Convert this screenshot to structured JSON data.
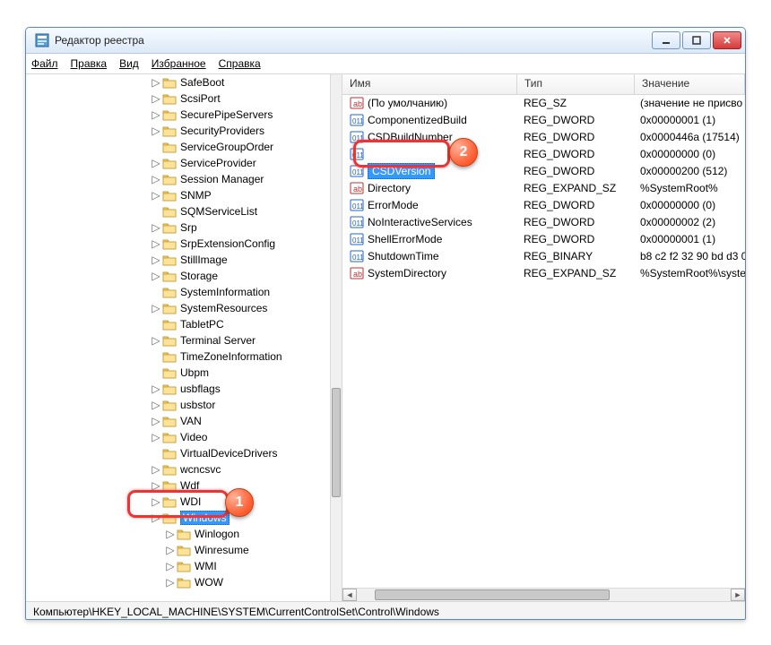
{
  "window": {
    "title": "Редактор реестра"
  },
  "menu": {
    "file": "Файл",
    "edit": "Правка",
    "view": "Вид",
    "favorites": "Избранное",
    "help": "Справка"
  },
  "tree": {
    "items": [
      {
        "label": "SafeBoot",
        "expandable": true,
        "indent": 0
      },
      {
        "label": "ScsiPort",
        "expandable": true,
        "indent": 0
      },
      {
        "label": "SecurePipeServers",
        "expandable": true,
        "indent": 0
      },
      {
        "label": "SecurityProviders",
        "expandable": true,
        "indent": 0
      },
      {
        "label": "ServiceGroupOrder",
        "expandable": false,
        "indent": 0
      },
      {
        "label": "ServiceProvider",
        "expandable": true,
        "indent": 0
      },
      {
        "label": "Session Manager",
        "expandable": true,
        "indent": 0
      },
      {
        "label": "SNMP",
        "expandable": true,
        "indent": 0
      },
      {
        "label": "SQMServiceList",
        "expandable": false,
        "indent": 0
      },
      {
        "label": "Srp",
        "expandable": true,
        "indent": 0
      },
      {
        "label": "SrpExtensionConfig",
        "expandable": true,
        "indent": 0
      },
      {
        "label": "StillImage",
        "expandable": true,
        "indent": 0
      },
      {
        "label": "Storage",
        "expandable": true,
        "indent": 0
      },
      {
        "label": "SystemInformation",
        "expandable": false,
        "indent": 0
      },
      {
        "label": "SystemResources",
        "expandable": true,
        "indent": 0
      },
      {
        "label": "TabletPC",
        "expandable": false,
        "indent": 0
      },
      {
        "label": "Terminal Server",
        "expandable": true,
        "indent": 0
      },
      {
        "label": "TimeZoneInformation",
        "expandable": false,
        "indent": 0
      },
      {
        "label": "Ubpm",
        "expandable": false,
        "indent": 0
      },
      {
        "label": "usbflags",
        "expandable": true,
        "indent": 0
      },
      {
        "label": "usbstor",
        "expandable": true,
        "indent": 0
      },
      {
        "label": "VAN",
        "expandable": true,
        "indent": 0
      },
      {
        "label": "Video",
        "expandable": true,
        "indent": 0
      },
      {
        "label": "VirtualDeviceDrivers",
        "expandable": false,
        "indent": 0
      },
      {
        "label": "wcncsvc",
        "expandable": true,
        "indent": 0
      },
      {
        "label": "Wdf",
        "expandable": true,
        "indent": 0
      },
      {
        "label": "WDI",
        "expandable": true,
        "indent": 0
      },
      {
        "label": "Windows",
        "expandable": true,
        "indent": 0,
        "selected": true
      },
      {
        "label": "Winlogon",
        "expandable": true,
        "indent": 1
      },
      {
        "label": "Winresume",
        "expandable": true,
        "indent": 1
      },
      {
        "label": "WMI",
        "expandable": true,
        "indent": 1
      },
      {
        "label": "WOW",
        "expandable": true,
        "indent": 1
      }
    ]
  },
  "list": {
    "cols": {
      "name": "Имя",
      "type": "Тип",
      "value": "Значение"
    },
    "rows": [
      {
        "icon": "str",
        "name": "(По умолчанию)",
        "type": "REG_SZ",
        "value": "(значение не присво"
      },
      {
        "icon": "bin",
        "name": "ComponentizedBuild",
        "type": "REG_DWORD",
        "value": "0x00000001 (1)"
      },
      {
        "icon": "bin",
        "name": "CSDBuildNumber",
        "type": "REG_DWORD",
        "value": "0x0000446a (17514)"
      },
      {
        "icon": "bin",
        "name": "",
        "type": "REG_DWORD",
        "value": "0x00000000 (0)"
      },
      {
        "icon": "bin",
        "name": "CSDVersion",
        "type": "REG_DWORD",
        "value": "0x00000200 (512)",
        "highlighted": true
      },
      {
        "icon": "str",
        "name": "Directory",
        "type": "REG_EXPAND_SZ",
        "value": "%SystemRoot%"
      },
      {
        "icon": "bin",
        "name": "ErrorMode",
        "type": "REG_DWORD",
        "value": "0x00000000 (0)"
      },
      {
        "icon": "bin",
        "name": "NoInteractiveServices",
        "type": "REG_DWORD",
        "value": "0x00000002 (2)"
      },
      {
        "icon": "bin",
        "name": "ShellErrorMode",
        "type": "REG_DWORD",
        "value": "0x00000001 (1)"
      },
      {
        "icon": "bin",
        "name": "ShutdownTime",
        "type": "REG_BINARY",
        "value": "b8 c2 f2 32 90 bd d3 0"
      },
      {
        "icon": "str",
        "name": "SystemDirectory",
        "type": "REG_EXPAND_SZ",
        "value": "%SystemRoot%\\syste"
      }
    ]
  },
  "statusbar": {
    "path": "Компьютер\\HKEY_LOCAL_MACHINE\\SYSTEM\\CurrentControlSet\\Control\\Windows"
  },
  "badges": {
    "1": "1",
    "2": "2"
  }
}
